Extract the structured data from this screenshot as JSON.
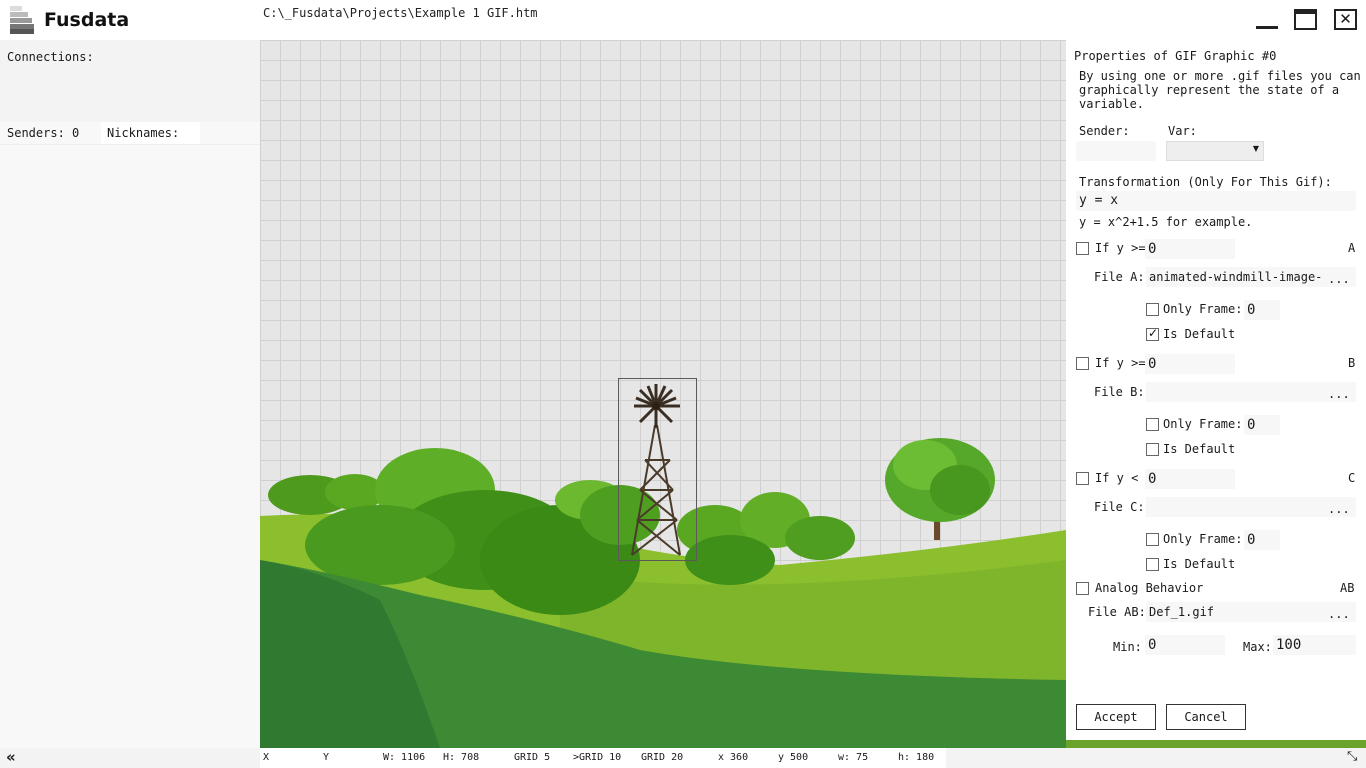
{
  "titlebar": {
    "app_name": "Fusdata",
    "file_path": "C:\\_Fusdata\\Projects\\Example 1 GIF.htm",
    "icons": [
      "logo-icon",
      "minimize-icon",
      "maximize-icon",
      "close-icon"
    ],
    "close_glyph": "✕"
  },
  "left_panel": {
    "connections_label": "Connections:",
    "senders_label": "Senders: 0",
    "nicknames_label": "Nicknames:"
  },
  "properties": {
    "title": "Properties of GIF Graphic #0",
    "description_lines": [
      "By using one or more .gif files you can",
      "graphically represent the state of a",
      "variable."
    ],
    "sender_label": "Sender:",
    "var_label": "Var:",
    "sender_value": "",
    "var_value": "",
    "transformation_label": "Transformation (Only For This Gif):",
    "transformation_value": "y = x",
    "transformation_hint": "y = x^2+1.5 for example.",
    "conditions": [
      {
        "letter": "A",
        "condition_label": "If y >=",
        "threshold": "0",
        "enabled": false,
        "file_label": "File A:",
        "file_value": "animated-windmill-image-",
        "only_frame_label": "Only Frame:",
        "only_frame_checked": false,
        "frame_value": "0",
        "is_default_label": "Is Default",
        "is_default_checked": true
      },
      {
        "letter": "B",
        "condition_label": "If y >=",
        "threshold": "0",
        "enabled": false,
        "file_label": "File B:",
        "file_value": "",
        "only_frame_label": "Only Frame:",
        "only_frame_checked": false,
        "frame_value": "0",
        "is_default_label": "Is Default",
        "is_default_checked": false
      },
      {
        "letter": "C",
        "condition_label": "If y <",
        "threshold": "0",
        "enabled": false,
        "file_label": "File C:",
        "file_value": "",
        "only_frame_label": "Only Frame:",
        "only_frame_checked": false,
        "frame_value": "0",
        "is_default_label": "Is Default",
        "is_default_checked": false
      }
    ],
    "browse_label": "...",
    "analog": {
      "label": "Analog Behavior",
      "letter": "AB",
      "checked": false,
      "file_label": "File AB:",
      "file_value": "Def_1.gif",
      "min_label": "Min:",
      "min_value": "0",
      "max_label": "Max:",
      "max_value": "100"
    },
    "accept_label": "Accept",
    "cancel_label": "Cancel"
  },
  "statusbar": {
    "collapse_glyph": "«",
    "resize_glyph": "⤡",
    "x_label": "X",
    "y_label": "Y",
    "width": "W: 1106",
    "height": "H: 708",
    "grid5": "GRID 5",
    "grid10": ">GRID 10",
    "grid20": "GRID 20",
    "sel_x": "x 360",
    "sel_y": "y 500",
    "sel_w": "w: 75",
    "sel_h": "h: 180"
  },
  "colors": {
    "grass_dark": "#3d8a35",
    "grass_light": "#8cbf2e",
    "bush": "#4e9a1c",
    "grid_bg": "#e6e6e6",
    "grid_line": "#d0d0d0"
  }
}
